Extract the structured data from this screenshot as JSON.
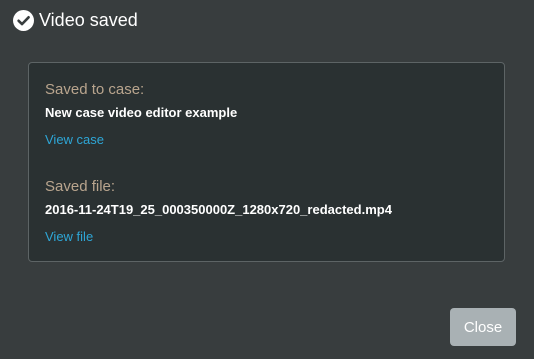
{
  "dialog": {
    "title": "Video saved",
    "check_icon": "check-circle-icon",
    "case_label": "Saved to case:",
    "case_name": "New case video editor example",
    "view_case_link": "View case",
    "file_label": "Saved file:",
    "file_name": "2016-11-24T19_25_000350000Z_1280x720_redacted.mp4",
    "view_file_link": "View file",
    "close_label": "Close"
  },
  "colors": {
    "background": "#383d3e",
    "panel": "#2a3132",
    "label": "#b9a58e",
    "link": "#2ea6d6",
    "button": "#a9b1b4"
  }
}
